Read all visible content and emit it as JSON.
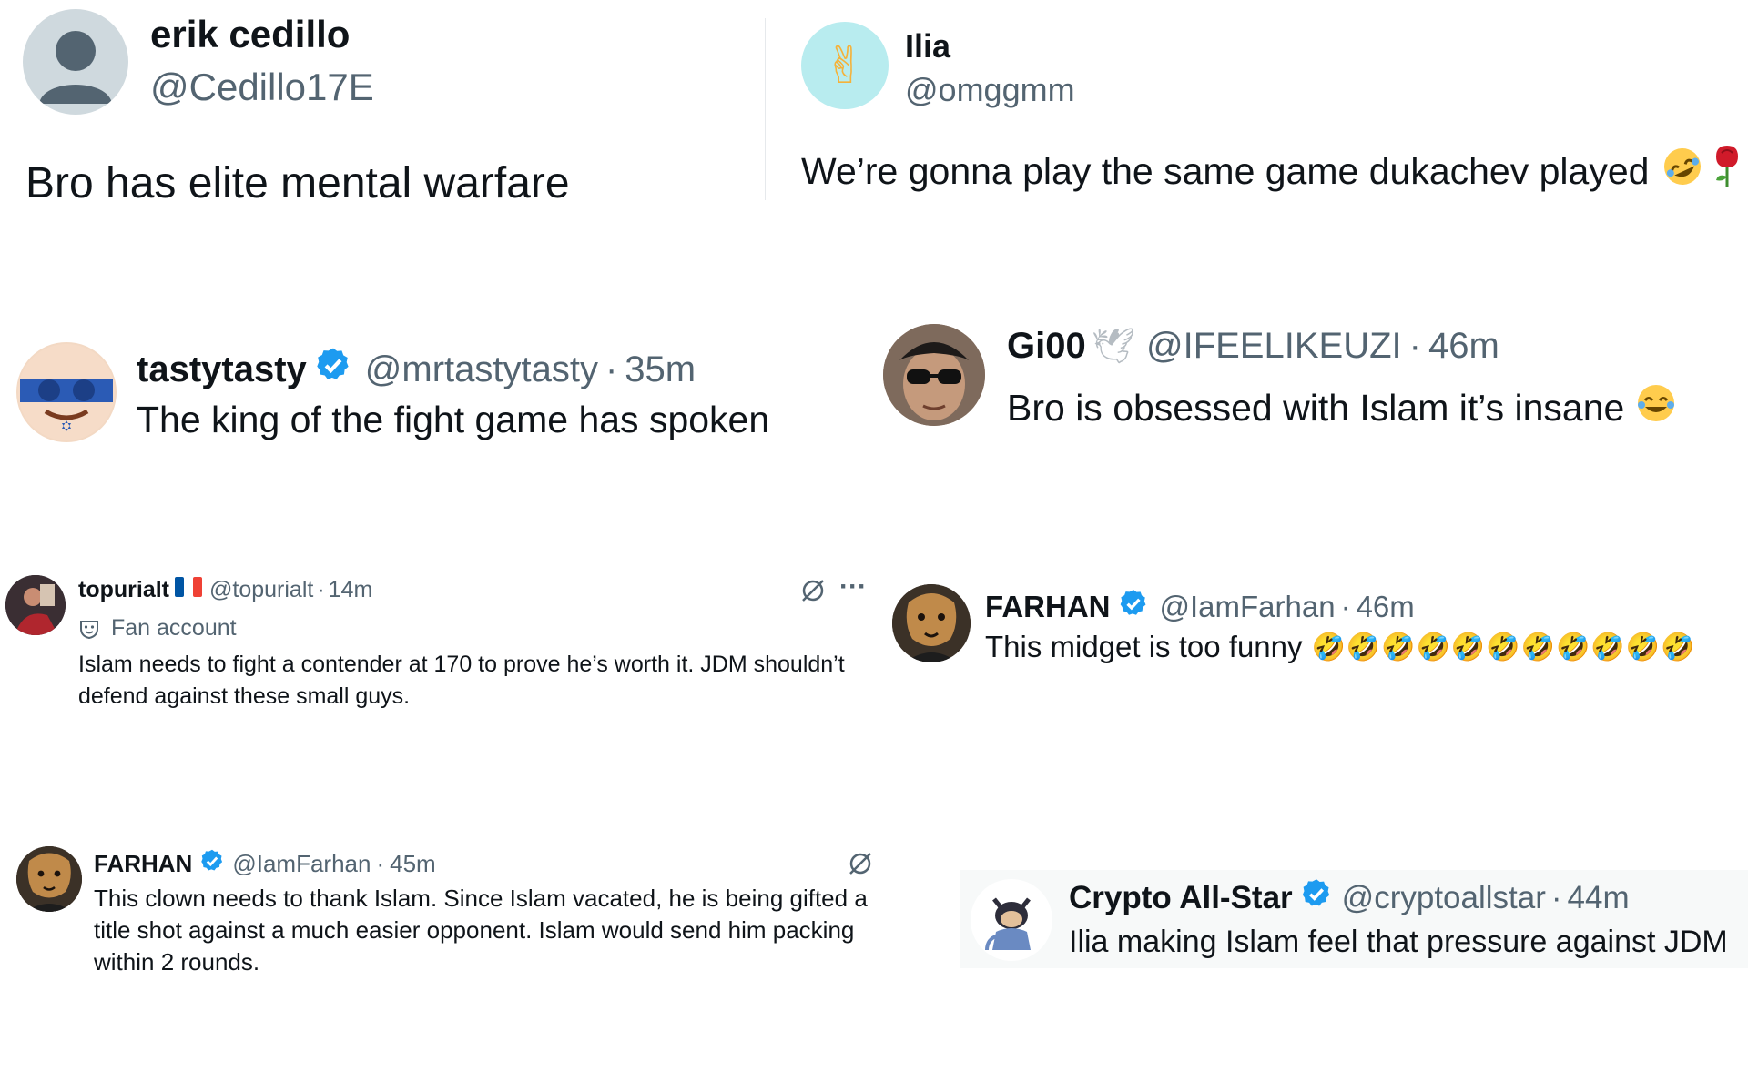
{
  "tweets": [
    {
      "name": "erik cedillo",
      "handle": "@Cedillo17E",
      "text": "Bro has elite mental warfare"
    },
    {
      "name": "Ilia",
      "handle": "@omggmm",
      "text": "We’re gonna play the same game dukachev played",
      "avatar_emoji": "✌",
      "text_emojis": [
        "🤣",
        "🌹"
      ]
    },
    {
      "name": "tastytasty",
      "handle": "@mrtastytasty",
      "time": "35m",
      "text": "The king of the fight game has spoken",
      "verified": true
    },
    {
      "name": "Gi00",
      "name_emoji": "🕊",
      "handle": "@IFEELIKEUZI",
      "time": "46m",
      "text": "Bro is obsessed with Islam it’s insane",
      "text_emoji": "😂"
    },
    {
      "name": "topurialt",
      "name_emoji": "🇫🇷",
      "handle": "@topurialt",
      "time": "14m",
      "badge": "Fan account",
      "text_lines": [
        "Islam needs to fight a contender at 170 to prove he’s worth it. JDM shouldn’t",
        "defend against these small guys."
      ],
      "more_label": "···"
    },
    {
      "name": "FARHAN",
      "handle": "@IamFarhan",
      "time": "46m",
      "text": "This midget is too funny",
      "verified": true,
      "emoji_repeat": "🤣🤣🤣🤣🤣🤣🤣🤣🤣🤣🤣"
    },
    {
      "name": "FARHAN",
      "handle": "@IamFarhan",
      "time": "45m",
      "verified": true,
      "text_lines": [
        "This clown needs to thank Islam. Since Islam vacated, he is being gifted a",
        "title shot against a much easier opponent. Islam would send him packing",
        "within 2 rounds."
      ]
    },
    {
      "name": "Crypto All-Star",
      "handle": "@cryptoallstar",
      "time": "44m",
      "text": "Ilia making Islam feel that pressure against JDM",
      "verified": true
    }
  ],
  "sep": "·",
  "colors": {
    "text": "#0f1419",
    "secondary": "#536471",
    "verified": "#1d9bf0",
    "highlight_bg": "#f7f9f9"
  }
}
